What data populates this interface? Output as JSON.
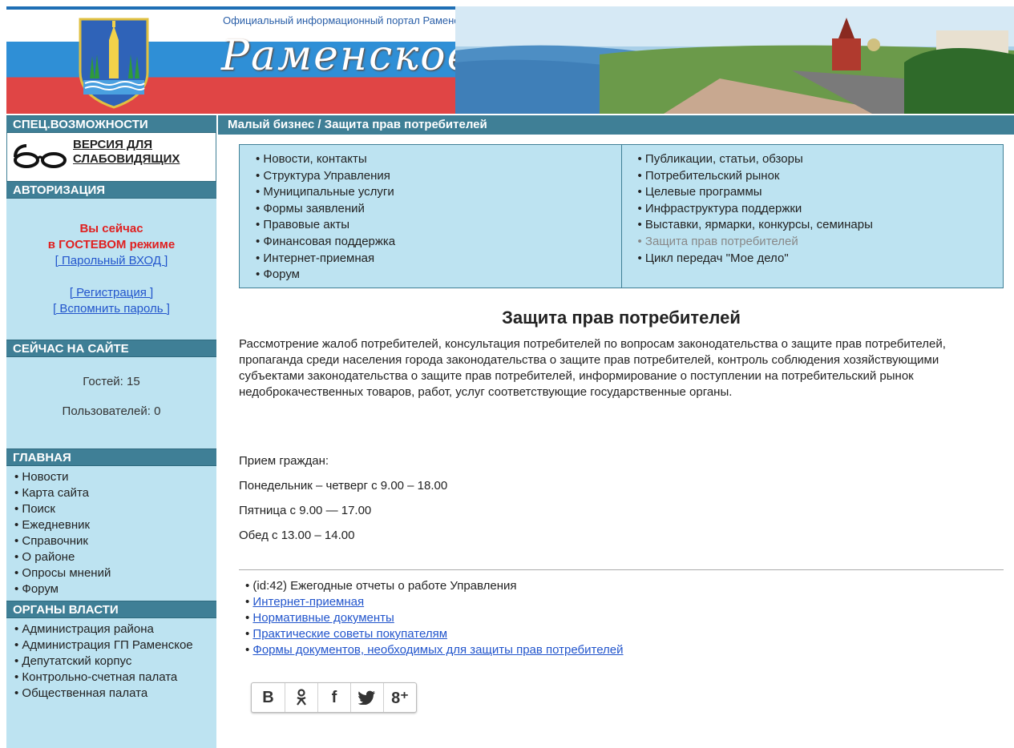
{
  "header": {
    "portal_caption": "Официальный информационный портал Раменского района",
    "logo_text": "Раменское",
    "colors": {
      "white_band": "#ffffff",
      "blue_band": "#2f8fd6",
      "red_band": "#e04545"
    }
  },
  "sidebar": {
    "accessibility_title": "СПЕЦ.ВОЗМОЖНОСТИ",
    "vision_link_line1": "ВЕРСИЯ ДЛЯ",
    "vision_link_line2": "СЛАБОВИДЯЩИХ",
    "auth_title": "АВТОРИЗАЦИЯ",
    "guest_line1": "Вы сейчас",
    "guest_line2": "в ГОСТЕВОМ режиме",
    "login_link": "[ Парольный ВХОД ]",
    "register_link": "[ Регистрация ]",
    "recover_link": "[ Вспомнить пароль ]",
    "online_title": "СЕЙЧАС НА САЙТЕ",
    "guests": "Гостей: 15",
    "users": "Пользователей: 0",
    "main_title": "ГЛАВНАЯ",
    "main_items": [
      "Новости",
      "Карта сайта",
      "Поиск",
      "Ежедневник",
      "Справочник",
      "О районе",
      "Опросы мнений",
      "Форум"
    ],
    "gov_title": "ОРГАНЫ ВЛАСТИ",
    "gov_items": [
      "Администрация района",
      "Администрация ГП Раменское",
      "Депутатский корпус",
      "Контрольно-счетная палата",
      "Общественная палата"
    ]
  },
  "breadcrumb": "Малый бизнес / Защита прав потребителей",
  "menu": {
    "left": [
      "Новости, контакты",
      "Структура Управления",
      "Муниципальные услуги",
      "Формы заявлений",
      "Правовые акты",
      "Финансовая поддержка",
      "Интернет-приемная",
      "Форум"
    ],
    "right": [
      "Публикации, статьи, обзоры",
      "Потребительский рынок",
      "Целевые программы",
      "Инфраструктура поддержки",
      "Выставки, ярмарки, конкурсы, семинары",
      "Защита прав потребителей",
      "Цикл передач \"Мое дело\""
    ],
    "active_item": "Защита прав потребителей"
  },
  "content": {
    "title": "Защита прав потребителей",
    "description": "Рассмотрение жалоб потребителей, консультация потребителей по вопросам законодательства о защите прав потребителей, пропаганда среди населения города законодательства о защите прав потребителей, контроль соблюдения хозяйствующими субъектами законодательства о защите прав потребителей, информирование о поступлении на потребительский рынок недоброкачественных товаров, работ, услуг соответствующие государственные органы.",
    "reception_label": "Прием граждан:",
    "hours_weekdays": "Понедельник – четверг с 9.00 – 18.00",
    "hours_friday": "Пятница с 9.00 — 17.00",
    "hours_lunch": "Обед с 13.00 – 14.00"
  },
  "links": {
    "plain_item": "(id:42) Ежегодные отчеты о работе Управления",
    "items": [
      "Интернет-приемная",
      "Нормативные документы",
      "Практические советы покупателям",
      "Формы документов, необходимых для защиты прав потребителей"
    ]
  },
  "social": {
    "vk": "В",
    "ok": "ok-icon",
    "fb": "f",
    "tw": "twitter-icon",
    "gp": "8⁺"
  }
}
